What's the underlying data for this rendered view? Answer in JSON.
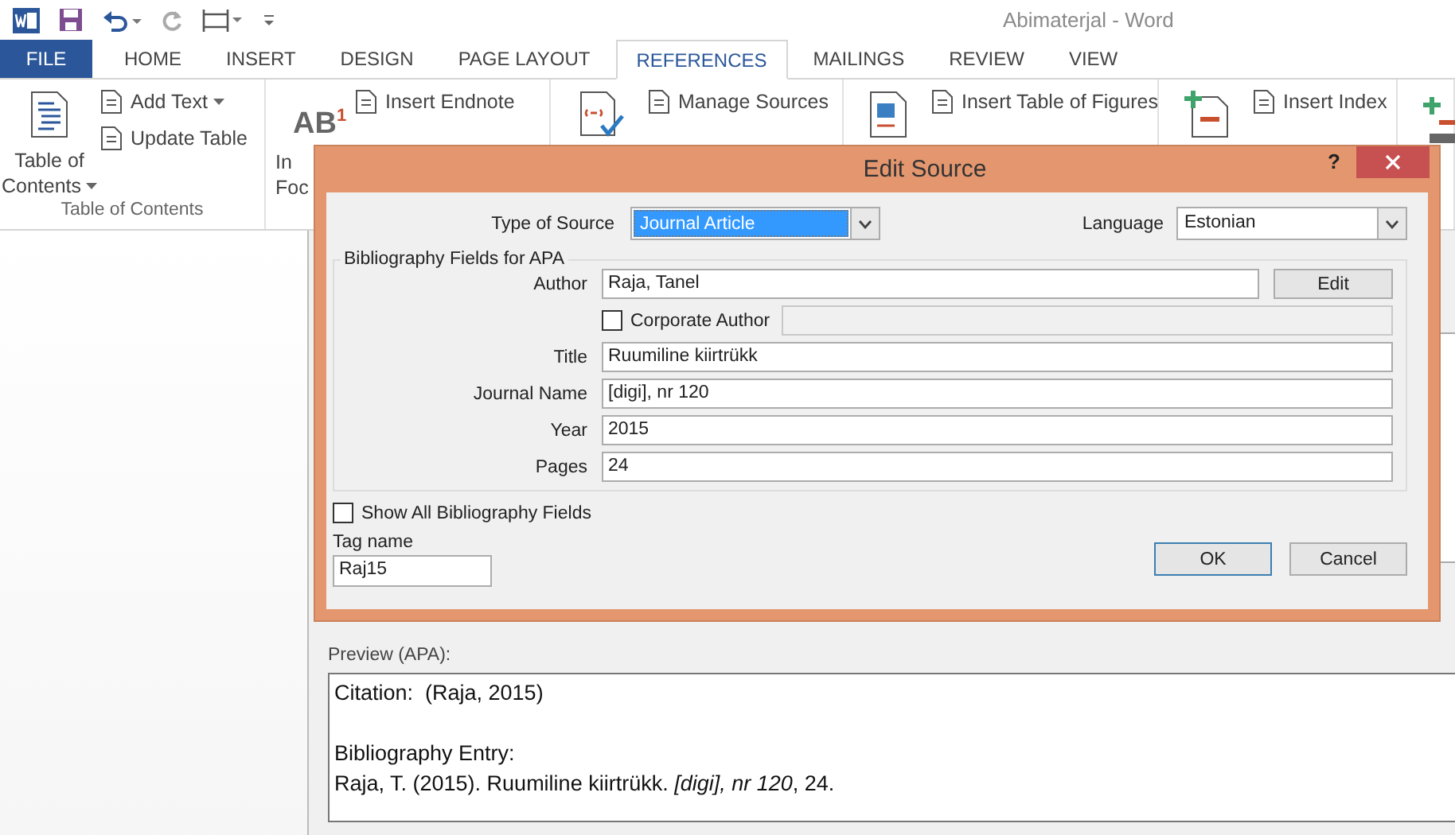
{
  "window": {
    "title": "Abimaterjal - Word"
  },
  "tabs": [
    {
      "label": "FILE",
      "kind": "file",
      "selected": false
    },
    {
      "label": "HOME",
      "kind": "tab",
      "selected": false
    },
    {
      "label": "INSERT",
      "kind": "tab",
      "selected": false
    },
    {
      "label": "DESIGN",
      "kind": "tab",
      "selected": false
    },
    {
      "label": "PAGE LAYOUT",
      "kind": "tab",
      "selected": false
    },
    {
      "label": "REFERENCES",
      "kind": "tab",
      "selected": true
    },
    {
      "label": "MAILINGS",
      "kind": "tab",
      "selected": false
    },
    {
      "label": "REVIEW",
      "kind": "tab",
      "selected": false
    },
    {
      "label": "VIEW",
      "kind": "tab",
      "selected": false
    }
  ],
  "ribbon": {
    "groups": [
      {
        "label": "Table of Contents",
        "large": {
          "lines": [
            "Table of",
            "Contents"
          ],
          "dropdown": true
        },
        "small": [
          {
            "label": "Add Text",
            "dropdown": true
          },
          {
            "label": "Update Table",
            "dropdown": false
          }
        ]
      },
      {
        "large": {
          "icon_text": "AB",
          "icon_sup": "1",
          "lines": [
            "In",
            "Foc"
          ]
        },
        "small": [
          {
            "label": "Insert Endnote",
            "dropdown": false
          }
        ]
      },
      {
        "small": [
          {
            "label": "Manage Sources",
            "dropdown": false
          }
        ]
      },
      {
        "small": [
          {
            "label": "Insert Table of Figures",
            "dropdown": false
          }
        ]
      },
      {
        "small": [
          {
            "label": "Insert Index",
            "dropdown": false
          }
        ]
      }
    ]
  },
  "source_manager": {
    "preview_label": "Preview (APA):",
    "citation": "Citation:  (Raja, 2015)",
    "bibliography": [
      "Bibliography Entry:",
      "Raja, T. (2015). Ruumiline kiirtrükk. *[digi], nr 120*, 24."
    ]
  },
  "edit_source": {
    "title": "Edit Source",
    "help": "?",
    "type_of_source": {
      "label": "Type of Source",
      "value": "Journal Article"
    },
    "language": {
      "label": "Language",
      "value": "Estonian"
    },
    "group_title": "Bibliography Fields for APA",
    "fields": [
      {
        "kind": "text",
        "label": "Author",
        "value": "Raja, Tanel",
        "button": "Edit"
      },
      {
        "kind": "checkbox",
        "label": "Corporate Author",
        "checked": false,
        "disabled": true
      },
      {
        "kind": "text",
        "label": "Title",
        "value": "Ruumiline kiirtrükk"
      },
      {
        "kind": "text",
        "label": "Journal Name",
        "value": "[digi], nr 120"
      },
      {
        "kind": "text",
        "label": "Year",
        "value": "2015"
      },
      {
        "kind": "text",
        "label": "Pages",
        "value": "24"
      }
    ],
    "show_all": {
      "label": "Show All Bibliography Fields",
      "checked": false
    },
    "tag_name": {
      "label": "Tag name",
      "value": "Raj15"
    },
    "buttons": [
      {
        "label": "OK",
        "default": true
      },
      {
        "label": "Cancel",
        "default": false
      }
    ]
  }
}
